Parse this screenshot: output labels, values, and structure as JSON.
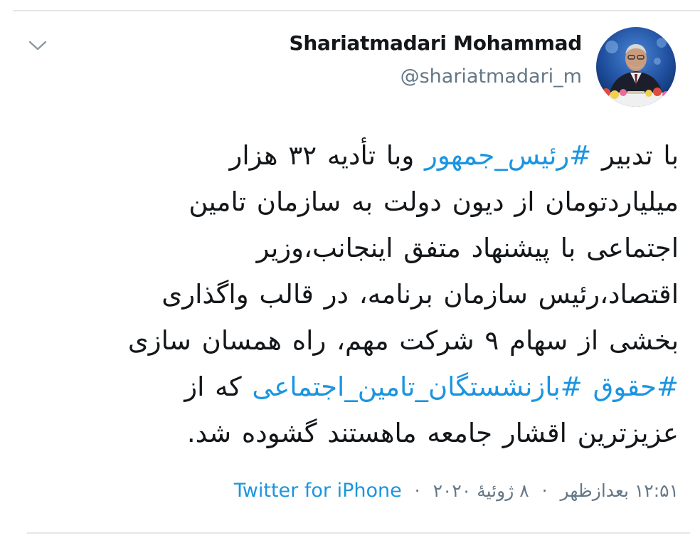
{
  "user": {
    "display_name": "Shariatmadari Mohammad",
    "handle": "@shariatmadari_m"
  },
  "tweet": {
    "lines": [
      [
        {
          "text": "با تدبیر ",
          "link": false
        },
        {
          "text": "#رئیس_جمهور",
          "link": true
        },
        {
          "text": " وبا تأدیه ۳۲ هزار",
          "link": false
        }
      ],
      [
        {
          "text": "میلیاردتومان از دیون دولت به سازمان تامین",
          "link": false
        }
      ],
      [
        {
          "text": "اجتماعی با پیشنهاد متفق اینجانب،وزیر",
          "link": false
        }
      ],
      [
        {
          "text": "اقتصاد،رئیس سازمان برنامه، در قالب واگذاری",
          "link": false
        }
      ],
      [
        {
          "text": "بخشی از سهام ۹ شرکت مهم، راه همسان سازی",
          "link": false
        }
      ],
      [
        {
          "text": "#حقوق",
          "link": true
        },
        {
          "text": " ",
          "link": false
        },
        {
          "text": "#بازنشستگان_تامین_اجتماعی",
          "link": true
        },
        {
          "text": " که از",
          "link": false
        }
      ],
      [
        {
          "text": "عزیزترین اقشار جامعه ماهستند گشوده شد.",
          "link": false
        }
      ]
    ]
  },
  "meta": {
    "time": "۱۲:۵۱ بعدازظهر",
    "separator": "·",
    "date": "۸ ژوئیهٔ ۲۰۲۰",
    "source": "Twitter for iPhone"
  },
  "icons": {
    "menu": "chevron-down-icon"
  },
  "colors": {
    "link": "#1b95e0",
    "text": "#14171a",
    "secondary": "#657786"
  }
}
